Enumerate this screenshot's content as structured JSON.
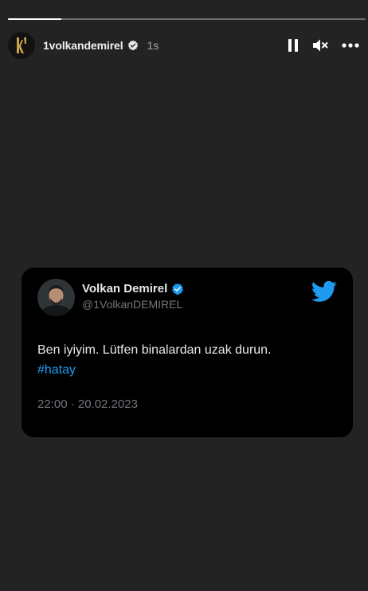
{
  "story": {
    "progress": 0.15,
    "username": "1volkandemirel",
    "time": "1s",
    "icons": {
      "avatar": "brand-logo-icon",
      "verified": "verified-badge-icon",
      "pause": "pause-icon",
      "mute": "speaker-muted-icon",
      "more": "more-options-icon"
    }
  },
  "tweet": {
    "display_name": "Volkan Demirel",
    "handle": "@1VolkanDEMIREL",
    "text": "Ben iyiyim. Lütfen binalardan uzak durun.",
    "hashtag": "#hatay",
    "datetime": "22:00 · 20.02.2023",
    "icons": {
      "verified": "verified-badge-icon",
      "brand": "twitter-bird-icon",
      "avatar": "profile-photo"
    }
  },
  "colors": {
    "background": "#232323",
    "card": "#000000",
    "verified_blue": "#1d9bf0",
    "hashtag": "#1d9bf0",
    "logo_gold": "#c9a24a"
  }
}
